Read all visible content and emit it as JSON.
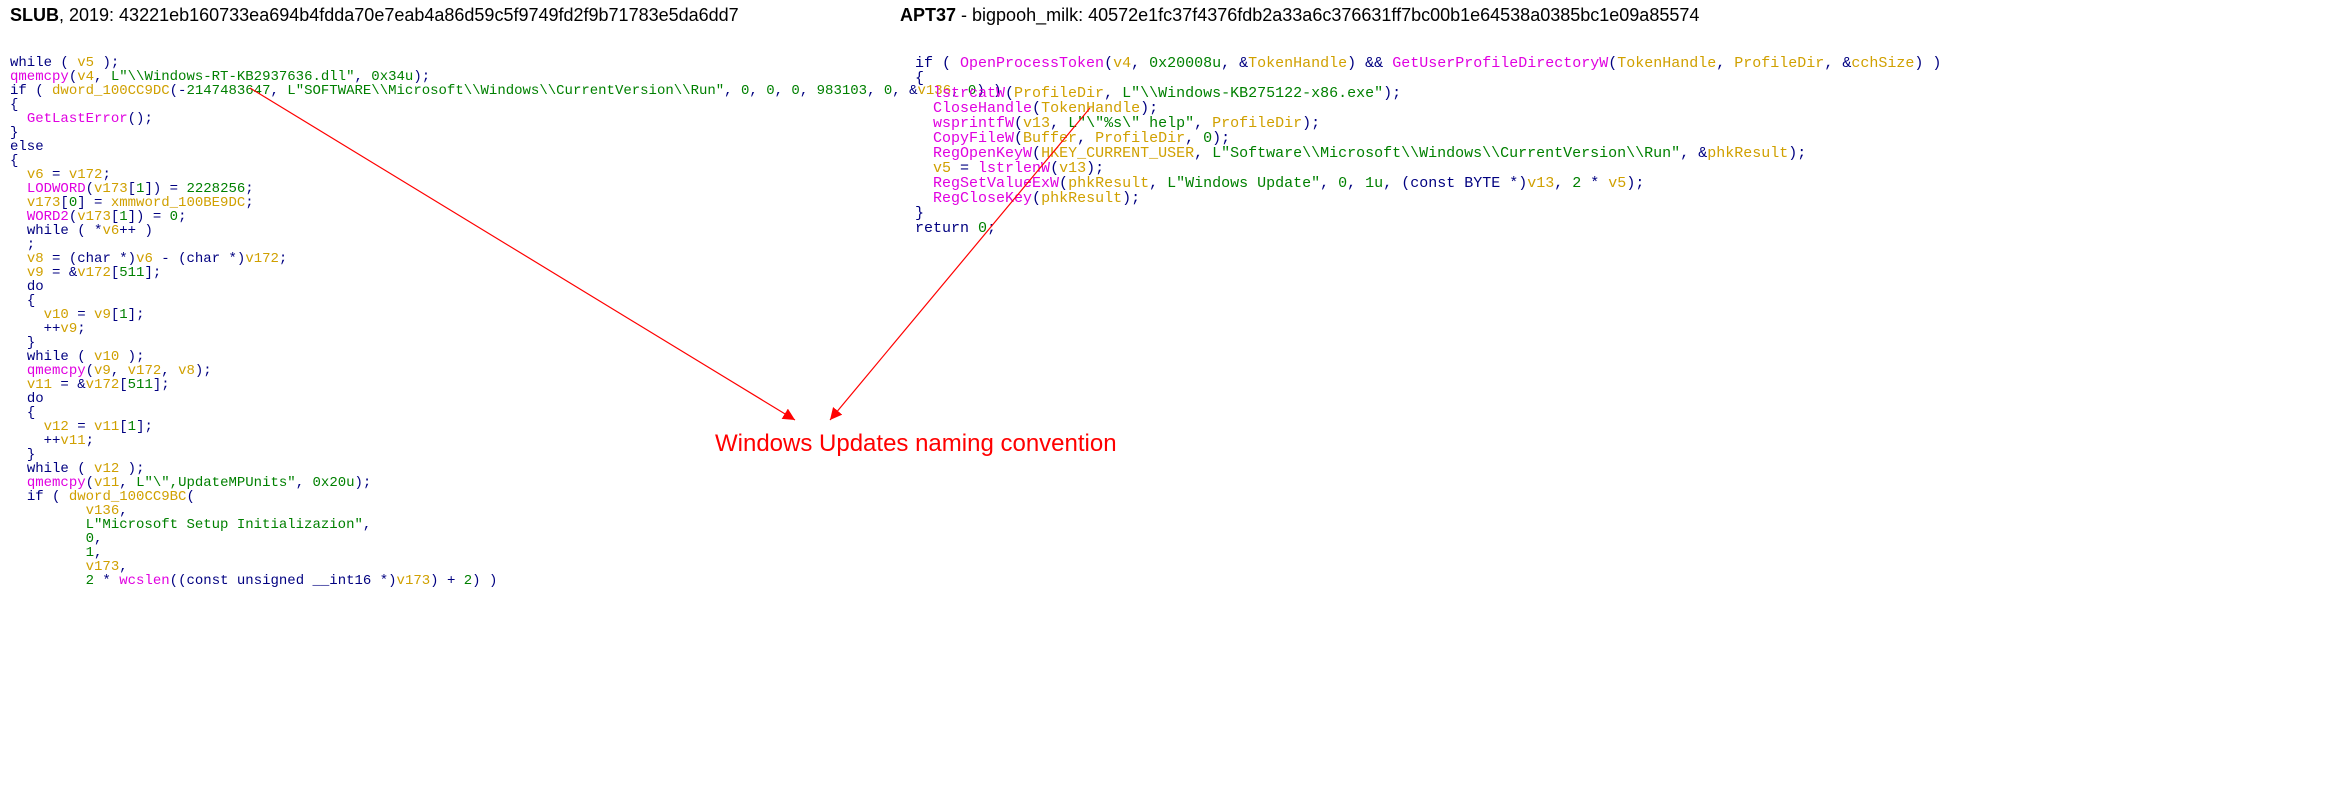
{
  "left": {
    "title_bold": "SLUB",
    "title_rest": ", 2019: 43221eb160733ea694b4fdda70e7eab4a86d59c5f9749fd2f9b71783e5da6dd7",
    "code": {
      "l1_a": "while",
      "l1_b": " ( ",
      "l1_v": "v5",
      "l1_c": " );",
      "l2_fn": "qmemcpy",
      "l2_a": "(",
      "l2_v1": "v4",
      "l2_b": ", ",
      "l2_s": "L\"\\\\Windows-RT-KB2937636.dll\"",
      "l2_c": ", ",
      "l2_n": "0x34u",
      "l2_d": ");",
      "l3_a": "if",
      "l3_b": " ( ",
      "l3_v": "dword_100CC9DC",
      "l3_c": "(-",
      "l3_n1": "2147483647",
      "l3_d": ", ",
      "l3_s": "L\"SOFTWARE\\\\Microsoft\\\\Windows\\\\CurrentVersion\\\\Run\"",
      "l3_e": ", ",
      "l3_n2": "0",
      "l3_f": ", ",
      "l3_n3": "0",
      "l3_g": ", ",
      "l3_n4": "0",
      "l3_h": ", ",
      "l3_n5": "983103",
      "l3_i": ", ",
      "l3_n6": "0",
      "l3_j": ", &",
      "l3_v2": "v136",
      "l3_k": ", ",
      "l3_n7": "0",
      "l3_l": ") )",
      "l4": "{",
      "l5_fn": "GetLastError",
      "l5_a": "();",
      "l6": "}",
      "l7_a": "else",
      "l8": "{",
      "l9_v": "v6",
      "l9_a": " = ",
      "l9_v2": "v172",
      "l9_b": ";",
      "l10_fn": "LODWORD",
      "l10_a": "(",
      "l10_v": "v173",
      "l10_b": "[",
      "l10_n": "1",
      "l10_c": "]) = ",
      "l10_n2": "2228256",
      "l10_d": ";",
      "l11_v": "v173",
      "l11_a": "[",
      "l11_n": "0",
      "l11_b": "] = ",
      "l11_v2": "xmmword_100BE9DC",
      "l11_c": ";",
      "l12_fn": "WORD2",
      "l12_a": "(",
      "l12_v": "v173",
      "l12_b": "[",
      "l12_n": "1",
      "l12_c": "]) = ",
      "l12_n2": "0",
      "l12_d": ";",
      "l13_a": "while",
      "l13_b": " ( *",
      "l13_v": "v6",
      "l13_c": "++ )",
      "l14": "  ;",
      "l15_v": "v8",
      "l15_a": " = (",
      "l15_t": "char",
      "l15_b": " *)",
      "l15_v2": "v6",
      "l15_c": " - (",
      "l15_t2": "char",
      "l15_d": " *)",
      "l15_v3": "v172",
      "l15_e": ";",
      "l16_v": "v9",
      "l16_a": " = &",
      "l16_v2": "v172",
      "l16_b": "[",
      "l16_n": "511",
      "l16_c": "];",
      "l17_a": "do",
      "l18": "{",
      "l19_v": "v10",
      "l19_a": " = ",
      "l19_v2": "v9",
      "l19_b": "[",
      "l19_n": "1",
      "l19_c": "];",
      "l20_a": "++",
      "l20_v": "v9",
      "l20_b": ";",
      "l21": "}",
      "l22_a": "while",
      "l22_b": " ( ",
      "l22_v": "v10",
      "l22_c": " );",
      "l23_fn": "qmemcpy",
      "l23_a": "(",
      "l23_v1": "v9",
      "l23_b": ", ",
      "l23_v2": "v172",
      "l23_c": ", ",
      "l23_v3": "v8",
      "l23_d": ");",
      "l24_v": "v11",
      "l24_a": " = &",
      "l24_v2": "v172",
      "l24_b": "[",
      "l24_n": "511",
      "l24_c": "];",
      "l25_a": "do",
      "l26": "{",
      "l27_v": "v12",
      "l27_a": " = ",
      "l27_v2": "v11",
      "l27_b": "[",
      "l27_n": "1",
      "l27_c": "];",
      "l28_a": "++",
      "l28_v": "v11",
      "l28_b": ";",
      "l29": "}",
      "l30_a": "while",
      "l30_b": " ( ",
      "l30_v": "v12",
      "l30_c": " );",
      "l31_fn": "qmemcpy",
      "l31_a": "(",
      "l31_v": "v11",
      "l31_b": ", ",
      "l31_s": "L\"\\\",UpdateMPUnits\"",
      "l31_c": ", ",
      "l31_n": "0x20u",
      "l31_d": ");",
      "l32_a": "if",
      "l32_b": " ( ",
      "l32_v": "dword_100CC9BC",
      "l32_c": "(",
      "l33_v": "v136",
      "l33_a": ",",
      "l34_s": "L\"Microsoft Setup Initializazion\"",
      "l34_a": ",",
      "l35_n": "0",
      "l35_a": ",",
      "l36_n": "1",
      "l36_a": ",",
      "l37_v": "v173",
      "l37_a": ",",
      "l38_n": "2",
      "l38_a": " * ",
      "l38_fn": "wcslen",
      "l38_b": "((",
      "l38_t": "const unsigned __int16",
      "l38_c": " *)",
      "l38_v": "v173",
      "l38_d": ") + ",
      "l38_n2": "2",
      "l38_e": ") )"
    }
  },
  "right": {
    "title_bold": "APT37",
    "title_rest": " - bigpooh_milk: 40572e1fc37f4376fdb2a33a6c376631ff7bc00b1e64538a0385bc1e09a85574",
    "code": {
      "l1_a": "if",
      "l1_b": " ( ",
      "l1_fn1": "OpenProcessToken",
      "l1_c": "(",
      "l1_v1": "v4",
      "l1_d": ", ",
      "l1_n1": "0x20008u",
      "l1_e": ", &",
      "l1_v2": "TokenHandle",
      "l1_f": ") && ",
      "l1_fn2": "GetUserProfileDirectoryW",
      "l1_g": "(",
      "l1_v3": "TokenHandle",
      "l1_h": ", ",
      "l1_v4": "ProfileDir",
      "l1_i": ", &",
      "l1_v5": "cchSize",
      "l1_j": ") )",
      "l2": "{",
      "l3_fn": "lstrcatW",
      "l3_a": "(",
      "l3_v": "ProfileDir",
      "l3_b": ", ",
      "l3_s": "L\"\\\\Windows-KB275122-x86.exe\"",
      "l3_c": ");",
      "l4_fn": "CloseHandle",
      "l4_a": "(",
      "l4_v": "TokenHandle",
      "l4_b": ");",
      "l5_fn": "wsprintfW",
      "l5_a": "(",
      "l5_v": "v13",
      "l5_b": ", ",
      "l5_s": "L\"\\\"%s\\\" help\"",
      "l5_c": ", ",
      "l5_v2": "ProfileDir",
      "l5_d": ");",
      "l6_fn": "CopyFileW",
      "l6_a": "(",
      "l6_v": "Buffer",
      "l6_b": ", ",
      "l6_v2": "ProfileDir",
      "l6_c": ", ",
      "l6_n": "0",
      "l6_d": ");",
      "l7_fn": "RegOpenKeyW",
      "l7_a": "(",
      "l7_v": "HKEY_CURRENT_USER",
      "l7_b": ", ",
      "l7_s": "L\"Software\\\\Microsoft\\\\Windows\\\\CurrentVersion\\\\Run\"",
      "l7_c": ", &",
      "l7_v2": "phkResult",
      "l7_d": ");",
      "l8_v": "v5",
      "l8_a": " = ",
      "l8_fn": "lstrlenW",
      "l8_b": "(",
      "l8_v2": "v13",
      "l8_c": ");",
      "l9_fn": "RegSetValueExW",
      "l9_a": "(",
      "l9_v": "phkResult",
      "l9_b": ", ",
      "l9_s": "L\"Windows Update\"",
      "l9_c": ", ",
      "l9_n1": "0",
      "l9_d": ", ",
      "l9_n2": "1u",
      "l9_e": ", (",
      "l9_t": "const BYTE",
      "l9_f": " *)",
      "l9_v2": "v13",
      "l9_g": ", ",
      "l9_n3": "2",
      "l9_h": " * ",
      "l9_v3": "v5",
      "l9_i": ");",
      "l10_fn": "RegCloseKey",
      "l10_a": "(",
      "l10_v": "phkResult",
      "l10_b": ");",
      "l11": "}",
      "l12_a": "return",
      "l12_b": " ",
      "l12_n": "0",
      "l12_c": ";"
    }
  },
  "annotation": "Windows Updates naming convention"
}
